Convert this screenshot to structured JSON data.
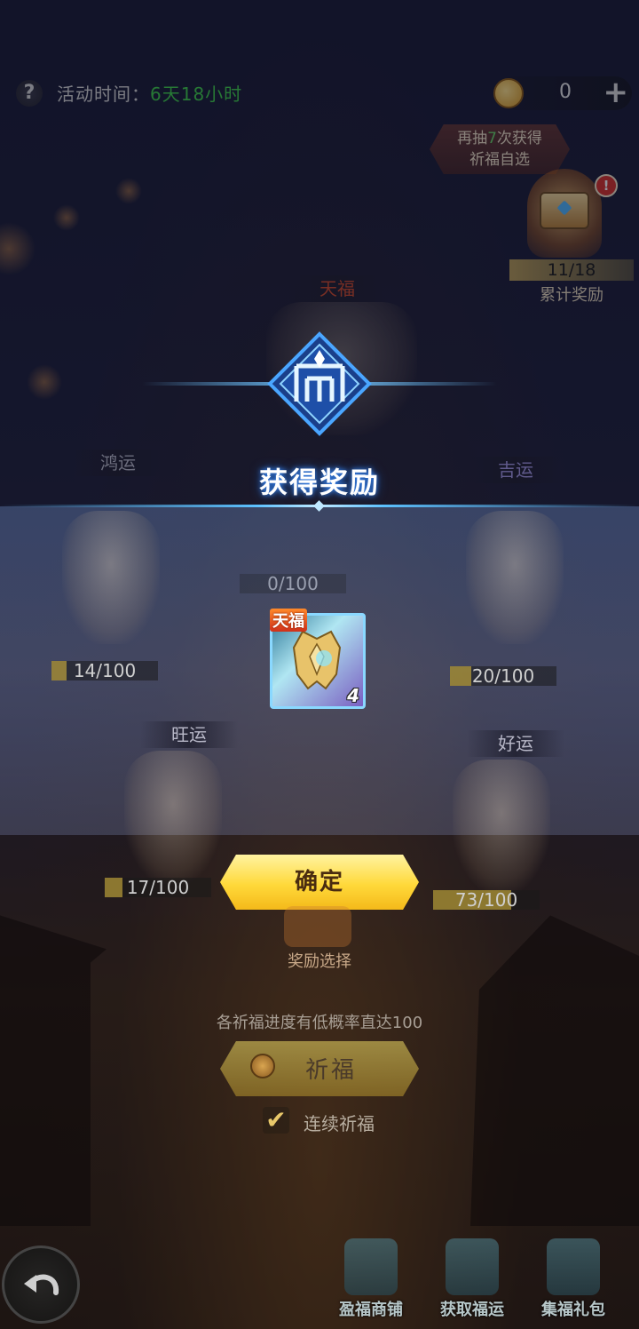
{
  "top_bar": {
    "help_icon": "question-icon",
    "event_time_label": "活动时间：",
    "event_time_value": "6天18小时",
    "currency_value": "0",
    "plus_label": "+"
  },
  "cumulative_reward": {
    "banner_prefix": "再抽",
    "banner_count": "7",
    "banner_suffix": "次获得",
    "banner_line2": "祈福自选",
    "alert": "!",
    "progress": "11/18",
    "label": "累计奖励"
  },
  "slots": [
    {
      "title": "天福",
      "progress": "0/100",
      "fill": 0.0
    },
    {
      "title": "鸿运",
      "progress": "14/100",
      "fill": 0.14
    },
    {
      "title": "吉运",
      "progress": "20/100",
      "fill": 0.2
    },
    {
      "title": "旺运",
      "progress": "17/100",
      "fill": 0.17
    },
    {
      "title": "好运",
      "progress": "73/100",
      "fill": 0.73
    }
  ],
  "reward_dialog": {
    "title": "获得奖励",
    "item": {
      "tier": "天福",
      "count": "4",
      "icon": "golden-wings-armor-icon"
    },
    "confirm_label": "确定"
  },
  "controls": {
    "reward_select_label": "奖励选择",
    "hint": "各祈福进度有低概率直达100",
    "pray_label": "祈福",
    "continuous_label": "连续祈福",
    "continuous_checked": true
  },
  "bottom_nav": [
    {
      "label": "盈福商铺",
      "icon": "shop-icon"
    },
    {
      "label": "获取福运",
      "icon": "book-icon"
    },
    {
      "label": "集福礼包",
      "icon": "gift-icon"
    }
  ],
  "colors": {
    "accent_green": "#3ecf4a",
    "confirm_yellow": "#ffd93a",
    "emblem_blue": "#5cc1ff"
  }
}
